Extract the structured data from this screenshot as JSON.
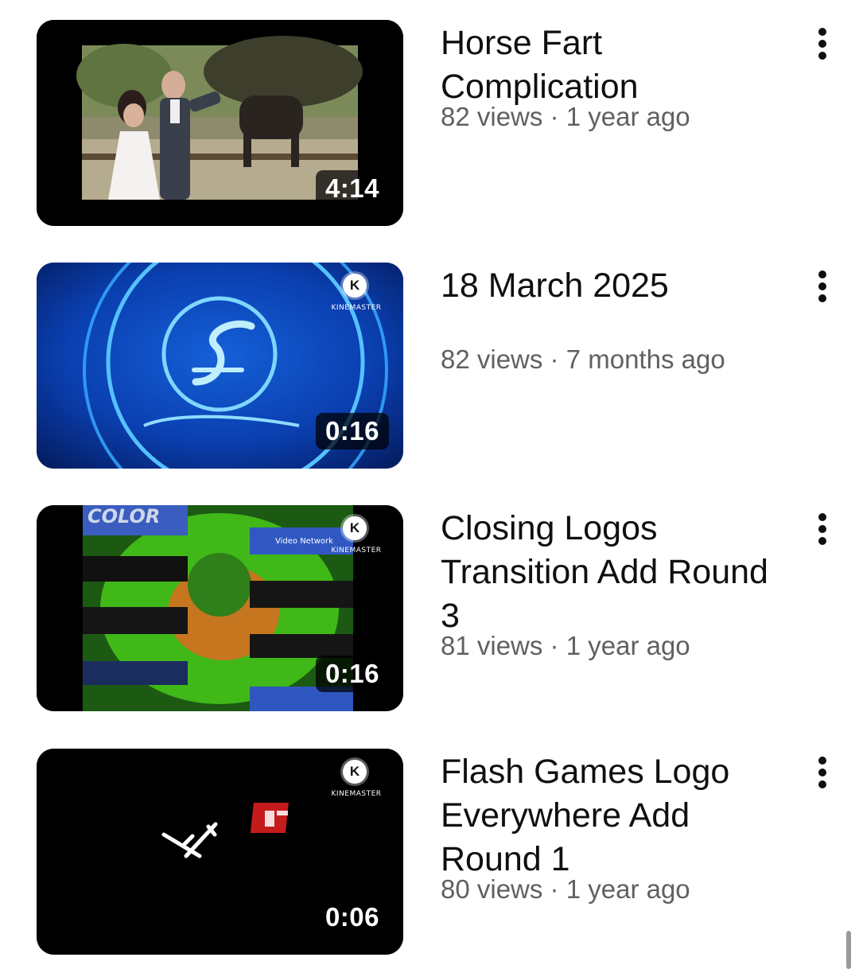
{
  "videos": [
    {
      "title": "Horse Fart Complication",
      "meta": "82 views · 1 year ago",
      "duration": "4:14",
      "watermark": ""
    },
    {
      "title": "18 March 2025",
      "meta": "82 views · 7 months ago",
      "duration": "0:16",
      "watermark": "KINEMASTER"
    },
    {
      "title": "Closing Logos Transition Add Round 3",
      "meta": "81 views · 1 year ago",
      "duration": "0:16",
      "watermark": "KINEMASTER"
    },
    {
      "title": "Flash Games Logo Everywhere Add Round 1",
      "meta": "80 views · 1 year ago",
      "duration": "0:06",
      "watermark": "KINEMASTER"
    }
  ],
  "thumb_text": {
    "color_logo": "COLOR",
    "video_network": "Video Network"
  },
  "icons": {
    "more": "more-vertical-icon",
    "kinemaster": "kinemaster-logo-icon",
    "kinemaster_letter": "K"
  },
  "colors": {
    "title": "#0f0f0f",
    "meta": "#606060",
    "background": "#ffffff"
  }
}
